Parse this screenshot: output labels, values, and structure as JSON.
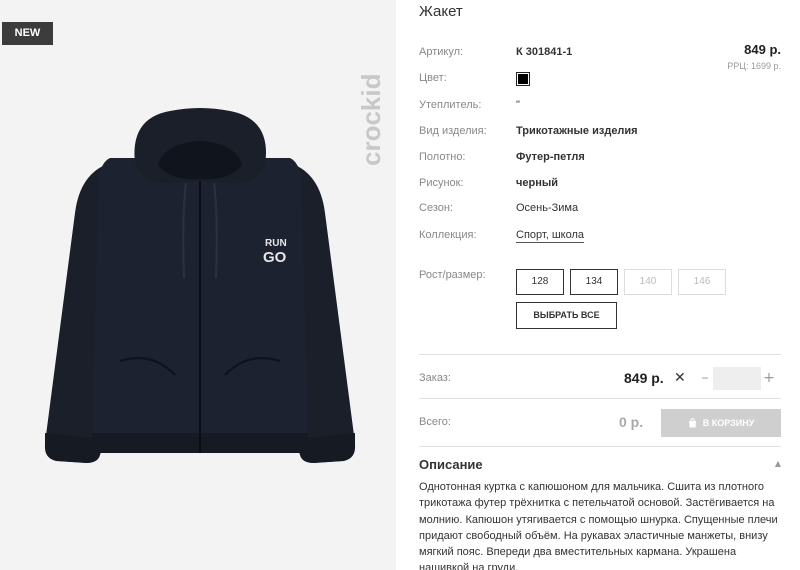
{
  "badge": "NEW",
  "brand": "crockid",
  "product": {
    "title": "Жакет",
    "price": "849 р.",
    "rrp": "РРЦ: 1699 р."
  },
  "attributes": {
    "article_label": "Артикул:",
    "article_value": "К 301841-1",
    "color_label": "Цвет:",
    "color_value": "#000000",
    "insulation_label": "Утеплитель:",
    "insulation_value": "\"",
    "type_label": "Вид изделия:",
    "type_value": "Трикотажные изделия",
    "fabric_label": "Полотно:",
    "fabric_value": "Футер-петля",
    "pattern_label": "Рисунок:",
    "pattern_value": "черный",
    "season_label": "Сезон:",
    "season_value": "Осень-Зима",
    "collection_label": "Коллекция:",
    "collection_value": "Спорт, школа"
  },
  "sizes": {
    "label": "Рост/размер:",
    "options": [
      {
        "value": "128",
        "available": true
      },
      {
        "value": "134",
        "available": true
      },
      {
        "value": "140",
        "available": false
      },
      {
        "value": "146",
        "available": false
      }
    ],
    "select_all": "ВЫБРАТЬ ВСЕ"
  },
  "order": {
    "label": "Заказ:",
    "price": "849 р.",
    "remove_symbol": "✕",
    "minus": "–",
    "plus": "+",
    "quantity": ""
  },
  "total": {
    "label": "Всего:",
    "value": "0 р.",
    "cart_button": "В КОРЗИНУ"
  },
  "description": {
    "heading": "Описание",
    "text": "Однотонная куртка с капюшоном для мальчика. Сшита из плотного трикотажа футер трёхнитка с петельчатой основой. Застёгивается на молнию. Капюшон утягивается с помощью шнурка. Спущенные плечи придают свободный объём. На рукавах эластичные манжеты, внизу мягкий пояс. Впереди два вместительных кармана. Украшена нашивкой на груди."
  },
  "print_text": {
    "line1": "RUN",
    "line2": "GO"
  },
  "colors": {
    "jacket": "#1a1f2a",
    "cart_button": "#cfcfcf"
  }
}
